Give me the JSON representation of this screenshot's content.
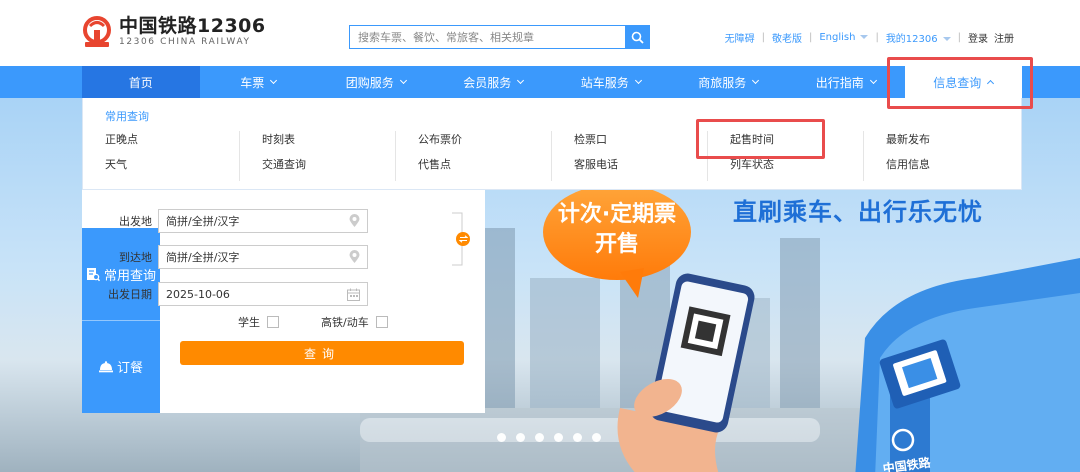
{
  "header": {
    "logo_cn": "中国铁路12306",
    "logo_en": "12306 CHINA RAILWAY",
    "search_placeholder": "搜索车票、餐饮、常旅客、相关规章",
    "links": {
      "accessible": "无障碍",
      "elder": "敬老版",
      "english": "English",
      "my12306": "我的12306",
      "login": "登录",
      "register": "注册"
    }
  },
  "nav": {
    "items": [
      "首页",
      "车票",
      "团购服务",
      "会员服务",
      "站车服务",
      "商旅服务",
      "出行指南",
      "信息查询"
    ]
  },
  "dropdown": {
    "title": "常用查询",
    "columns": [
      [
        "正晚点",
        "天气"
      ],
      [
        "时刻表",
        "交通查询"
      ],
      [
        "公布票价",
        "代售点"
      ],
      [
        "检票口",
        "客服电话"
      ],
      [
        "起售时间",
        "列车状态"
      ],
      [
        "最新发布",
        "信用信息"
      ]
    ]
  },
  "booking": {
    "tabs": [
      "常用查询",
      "订餐"
    ],
    "from_label": "出发地",
    "from_value": "简拼/全拼/汉字",
    "to_label": "到达地",
    "to_value": "简拼/全拼/汉字",
    "date_label": "出发日期",
    "date_value": "2025-10-06",
    "student_label": "学生",
    "highspeed_label": "高铁/动车",
    "query_label": "查询"
  },
  "banner": {
    "bubble_line1": "计次·定期票",
    "bubble_line2": "开售",
    "slogan": "直刷乘车、出行乐无忧",
    "kiosk_text": "中国铁路",
    "dots": 6
  },
  "colors": {
    "brand_blue": "#3b99fc",
    "nav_home": "#2676e3",
    "orange": "#ff8a00",
    "highlight_red": "#e94c4c",
    "logo_red": "#e8452f"
  }
}
